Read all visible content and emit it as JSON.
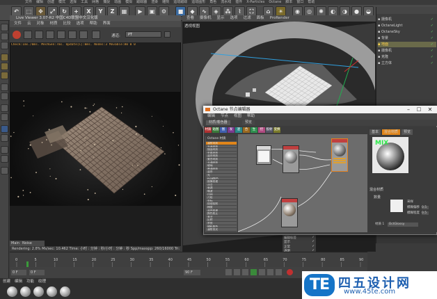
{
  "top_menu": [
    "文件",
    "编辑",
    "创建",
    "模式",
    "选择",
    "工具",
    "网格",
    "捕捉",
    "动画",
    "模拟",
    "跟踪器",
    "渲染",
    "雕刻",
    "运动跟踪",
    "运动图形",
    "角色",
    "流水线",
    "插件",
    "X-Particles",
    "Octane",
    "脚本",
    "窗口",
    "帮助"
  ],
  "toolbar": {
    "axis_x": "X",
    "axis_y": "Y",
    "axis_z": "Z"
  },
  "live_viewer": {
    "title": "Live Viewer 3.07-R2 中国C4D联盟中文汉化版",
    "menu": [
      "文件",
      "云",
      "对象",
      "材质",
      "比较",
      "选项",
      "帮助",
      "界面"
    ],
    "channel_label": "通道:",
    "channel_value": "PT",
    "status_line": "Check:1ms./0ms. MeshGen:7ms. Update[C]:0ms. Nodes:3 Movable:80  0  0",
    "tab_main": "Main",
    "tab_noise": "Noise",
    "render_status": "Rendering: 2.8%   Ms/sec: 10.462   Time: 小时 : 分钟 : 秒/小时 : 分钟 : 秒   Spp/maxspp: 260/16000   Tri: 0/300k   Mesh: 41"
  },
  "right_viewport": {
    "menu": [
      "查看",
      "摄像机",
      "显示",
      "选项",
      "过滤",
      "面板",
      "ProRender"
    ],
    "label": "透视视图"
  },
  "object_manager": {
    "items": [
      "摄像机",
      "OctaneLight",
      "OctaneSky",
      "背景",
      "地面",
      "摄像机",
      "克隆",
      "立方体"
    ],
    "selected_index": 4
  },
  "node_editor": {
    "title": "Octane 节点编辑器",
    "menu": [
      "编辑",
      "节点",
      "视图",
      "帮助"
    ],
    "tabs": [
      "材质/着色器",
      "预览"
    ],
    "chip_labels": [
      "材质",
      "贴图",
      "图",
      "发",
      "混",
      "合",
      "生",
      "控",
      "投射",
      "变换"
    ],
    "chip_colors": [
      "#b03030",
      "#3a7a3a",
      "#4060b0",
      "#7a3a90",
      "#2a8a8a",
      "#9a6a20",
      "#2f8f4f",
      "#b04a80",
      "#556",
      "#7a7a2a"
    ],
    "list_header": "Octane 材质",
    "list_items": [
      "漫射材质",
      "光泽材质",
      "镜面材质",
      "金属材质",
      "混合材质",
      "复合材质",
      "卡通材质",
      "玻璃",
      "普通材质",
      "混合",
      "光",
      "RGB颜色",
      "图像纹理",
      "浮点",
      "衰减",
      "噪波",
      "比例",
      "污垢",
      "坐标",
      "纹理投射",
      "梯度",
      "混合纹理",
      "颜色校正",
      "乘法",
      "反转",
      "余弦",
      "随机颜色",
      "漫射发光"
    ],
    "list_selected_index": 0,
    "material_tabs": [
      "基本",
      "混合材质",
      "预览"
    ],
    "material_preview_text": "MIX",
    "mixed_material_label": "混合材质",
    "amount_label": "数量",
    "params": [
      {
        "label": "采样",
        "value": ""
      },
      {
        "label": "模糊偏移",
        "value": "0.5"
      },
      {
        "label": "模糊程度",
        "value": "0.5"
      }
    ],
    "material_name_label": "材质 1",
    "material_name_value": "OctGlossy"
  },
  "attr_panel": {
    "rows": [
      "编辑标签",
      "显示",
      "正常",
      "透明",
      "启用",
      "优先",
      "轨迹",
      "交互",
      "分层"
    ]
  },
  "timeline": {
    "ticks": [
      "0",
      "5",
      "10",
      "15",
      "20",
      "25",
      "30",
      "35",
      "40",
      "45",
      "50",
      "55",
      "60",
      "65",
      "70",
      "75",
      "80",
      "85",
      "90"
    ],
    "current_frame": "0 F",
    "start_frame": "0 F",
    "end_frame": "90 F"
  },
  "material_bar": {
    "menu": [
      "创建",
      "编辑",
      "功能",
      "纹理"
    ],
    "ball_count": 5
  },
  "watermark": {
    "logo_text": "TE",
    "brand_name": "四五设计网",
    "url": "www.45te.com"
  }
}
